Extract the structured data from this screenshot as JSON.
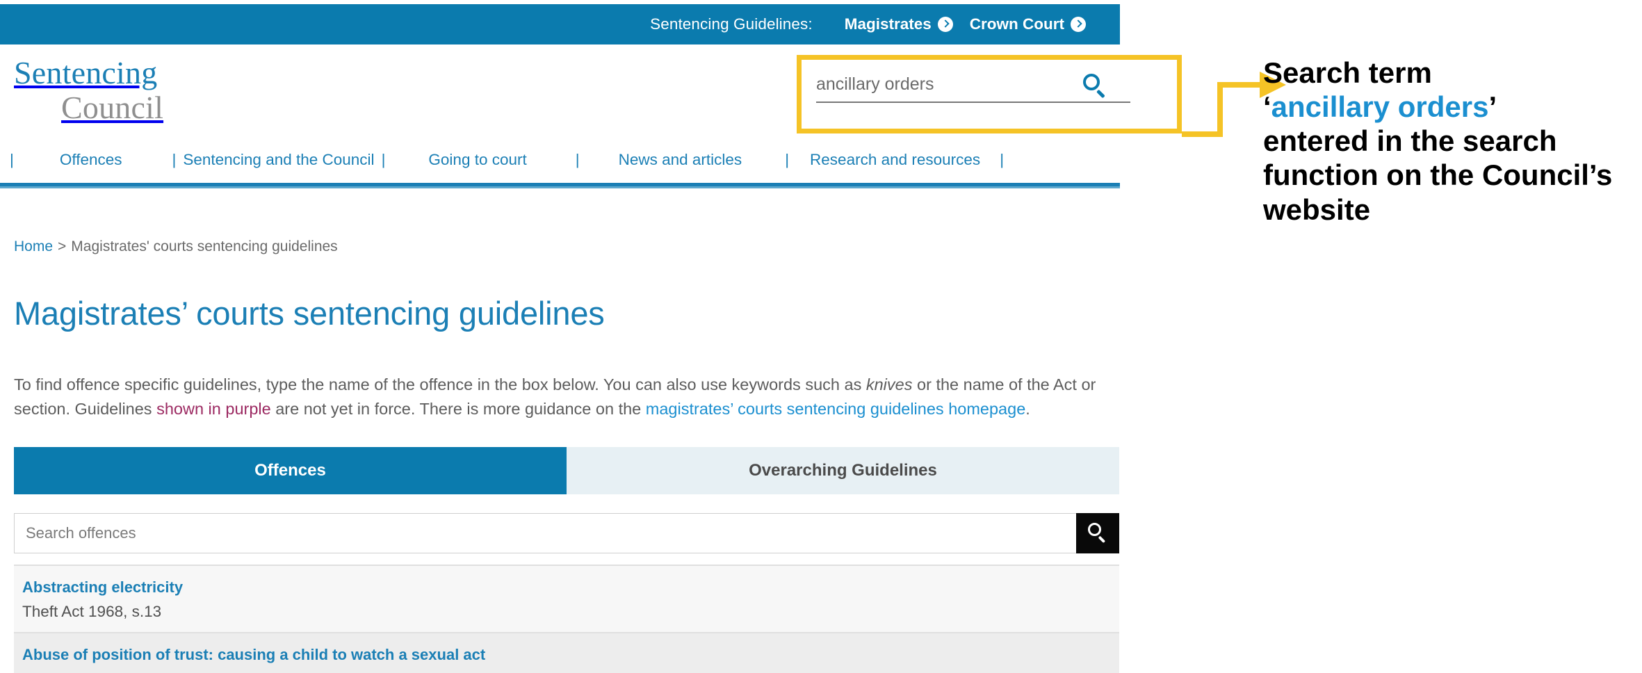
{
  "colors": {
    "brand_blue": "#0b7bae",
    "link_blue": "#1b7fb5",
    "accent_blue": "#1b8fd0",
    "highlight_yellow": "#f5c326",
    "purple": "#9c2a62",
    "tab_inactive_bg": "#e7f0f4"
  },
  "topbar": {
    "label": "Sentencing Guidelines:",
    "links": [
      {
        "label": "Magistrates",
        "icon": "chevron-right-circle-icon"
      },
      {
        "label": "Crown Court",
        "icon": "chevron-right-circle-icon"
      }
    ]
  },
  "logo": {
    "line1": "Sentencing",
    "line2": "Council"
  },
  "header_search": {
    "value": "ancillary orders",
    "placeholder": "Search",
    "icon": "search-icon"
  },
  "mainnav": {
    "items": [
      {
        "label": "Offences"
      },
      {
        "label": "Sentencing and the Council"
      },
      {
        "label": "Going to court"
      },
      {
        "label": "News and articles"
      },
      {
        "label": "Research and resources"
      }
    ],
    "separator": "|"
  },
  "breadcrumb": {
    "home": "Home",
    "separator": ">",
    "current": "Magistrates' courts sentencing guidelines"
  },
  "page": {
    "title": "Magistrates’ courts sentencing guidelines",
    "intro": {
      "part1": "To find offence specific guidelines, type the name of the offence in the box below. You can also use keywords such as ",
      "italic": "knives",
      "part2": " or the name of the Act or section. Guidelines ",
      "purple": "shown in purple",
      "part3": " are not yet in force. There is more guidance on the ",
      "link": "magistrates’ courts sentencing guidelines homepage",
      "part4": "."
    }
  },
  "tabs": [
    {
      "label": "Offences",
      "active": true
    },
    {
      "label": "Overarching Guidelines",
      "active": false
    }
  ],
  "offence_search": {
    "value": "",
    "placeholder": "Search offences",
    "button_icon": "search-icon"
  },
  "results": [
    {
      "title": "Abstracting electricity",
      "subtitle": "Theft Act 1968, s.13"
    },
    {
      "title": "Abuse of position of trust: causing a child to watch a sexual act",
      "subtitle": ""
    }
  ],
  "annotation": {
    "line1": "Search term",
    "quote_open": "‘",
    "highlight": "ancillary orders",
    "quote_close": "’",
    "rest": "entered in the search function on the Council’s website"
  }
}
